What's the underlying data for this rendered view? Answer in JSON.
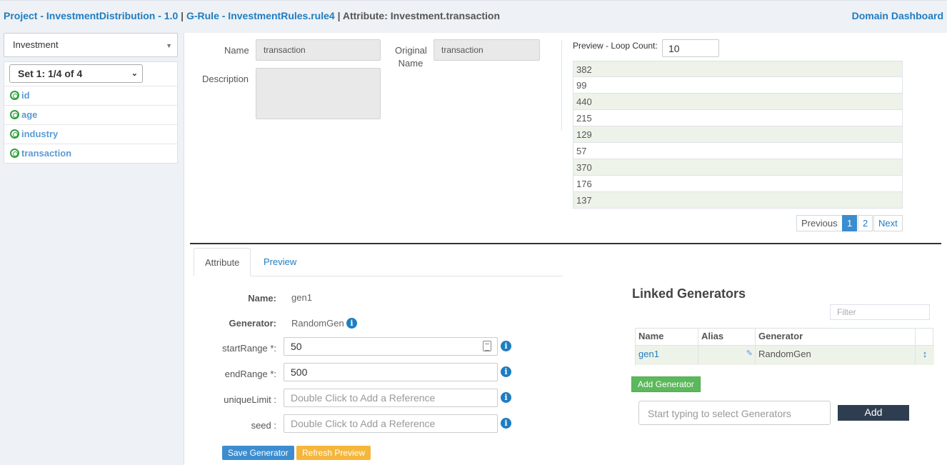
{
  "header": {
    "project_link": "Project - InvestmentDistribution - 1.0",
    "separator": "|",
    "rule_link": "G-Rule - InvestmentRules.rule4",
    "attribute_text": "Attribute: Investment.transaction",
    "dashboard_link": "Domain Dashboard"
  },
  "sidebar": {
    "entity_select": "Investment",
    "set_select": "Set 1: 1/4 of 4",
    "items": [
      "id",
      "age",
      "industry",
      "transaction"
    ]
  },
  "details": {
    "name_label": "Name",
    "name_value": "transaction",
    "original_label_1": "Original",
    "original_label_2": "Name",
    "original_value": "transaction",
    "description_label": "Description"
  },
  "preview": {
    "loop_label": "Preview - Loop Count:",
    "loop_value": "10",
    "values": [
      "382",
      "99",
      "440",
      "215",
      "129",
      "57",
      "370",
      "176",
      "137"
    ],
    "pagination": {
      "previous": "Previous",
      "pages": [
        "1",
        "2"
      ],
      "next": "Next"
    }
  },
  "tabs": [
    "Attribute",
    "Preview"
  ],
  "form": {
    "name_label": "Name:",
    "name_value": "gen1",
    "generator_label": "Generator:",
    "generator_value": "RandomGen",
    "start_label": "startRange *:",
    "start_value": "50",
    "end_label": "endRange *:",
    "end_value": "500",
    "unique_label": "uniqueLimit :",
    "unique_placeholder": "Double Click to Add a Reference",
    "seed_label": "seed :",
    "seed_placeholder": "Double Click to Add a Reference",
    "save_button": "Save Generator",
    "refresh_button": "Refresh Preview"
  },
  "linked": {
    "title": "Linked Generators",
    "filter_placeholder": "Filter",
    "columns": [
      "Name",
      "Alias",
      "Generator"
    ],
    "rows": [
      {
        "name": "gen1",
        "alias": "",
        "generator": "RandomGen"
      }
    ],
    "add_generator_button": "Add Generator",
    "search_placeholder": "Start typing to select Generators",
    "add_button": "Add"
  },
  "colors": {
    "link": "#1f7dc1",
    "accent_green": "#5cb85c",
    "dark_button": "#2e3e50",
    "warning": "#f5b63c"
  }
}
